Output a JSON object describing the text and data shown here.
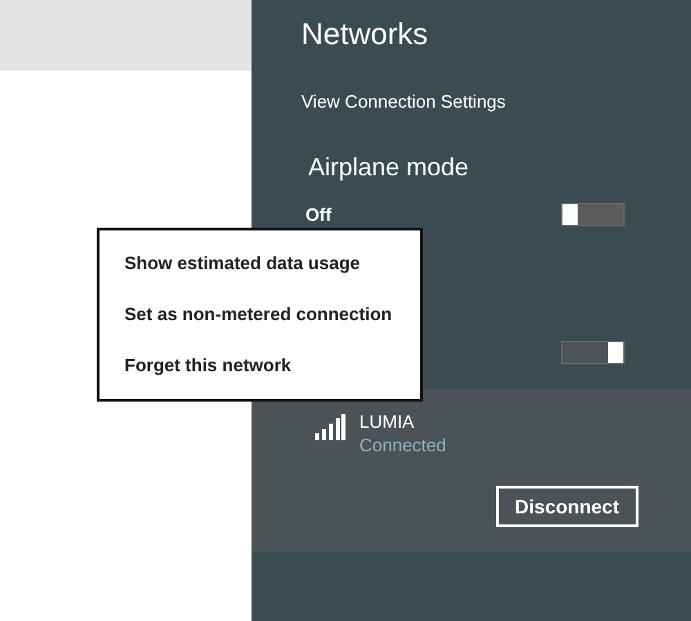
{
  "panel": {
    "title": "Networks",
    "settings_link": "View Connection Settings",
    "airplane_mode": {
      "label": "Airplane mode",
      "state_text": "Off",
      "on": false
    },
    "wifi_toggle": {
      "on": true
    },
    "networks": [
      {
        "name": "LUMIA",
        "status": "Connected",
        "selected": true
      }
    ],
    "disconnect_button": "Disconnect"
  },
  "context_menu": {
    "items": [
      {
        "label": "Show estimated data usage"
      },
      {
        "label": "Set as non-metered connection"
      },
      {
        "label": "Forget this network"
      }
    ]
  }
}
